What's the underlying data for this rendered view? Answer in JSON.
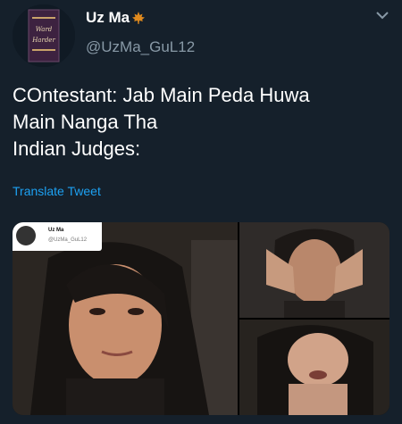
{
  "tweet": {
    "display_name": "Uz Ma",
    "name_emoji_icon": "maple-leaf-icon",
    "handle": "@UzMa_GuL12",
    "text_lines": [
      "COntestant: Jab Main Peda Huwa",
      "Main Nanga Tha",
      "Indian Judges:"
    ],
    "translate_label": "Translate Tweet"
  },
  "media": {
    "embedded_header": {
      "name": "Uz Ma",
      "handle": "@UzMa_GuL12"
    }
  },
  "colors": {
    "background": "#15202b",
    "secondary_text": "#8899a6",
    "link": "#1da1f2"
  }
}
